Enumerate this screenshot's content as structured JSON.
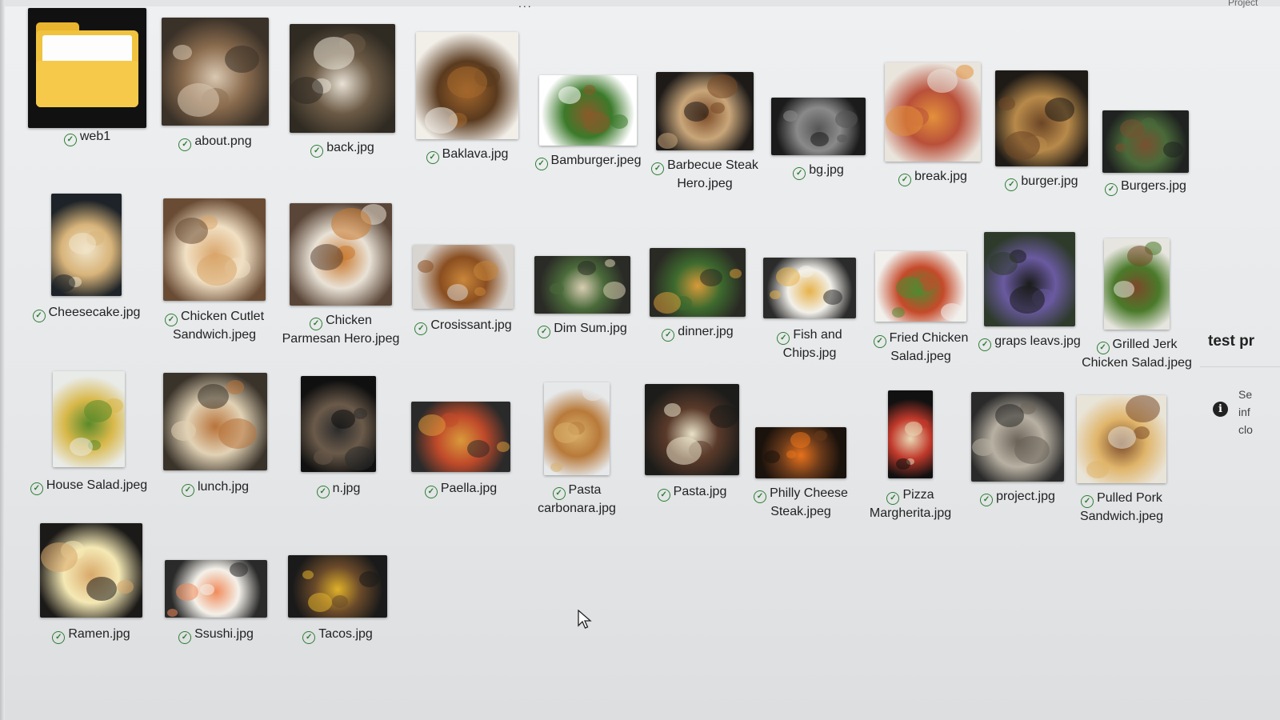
{
  "top": {
    "ellipsis": "...",
    "right_text": "Project"
  },
  "files": [
    {
      "name": "web1",
      "type": "folder",
      "colors": [
        "#111111",
        "#f0c23e"
      ]
    },
    {
      "name": "about.png",
      "colors": [
        "#3a3128",
        "#d9c8b2",
        "#8c6d4f"
      ]
    },
    {
      "name": "back.jpg",
      "colors": [
        "#2f2a22",
        "#e8e1d5",
        "#6b5a45"
      ]
    },
    {
      "name": "Baklava.jpg",
      "colors": [
        "#f2efe9",
        "#a4672c",
        "#5a3a1e"
      ]
    },
    {
      "name": "Bamburger.jpeg",
      "colors": [
        "#ffffff",
        "#8a5a2a",
        "#3b7a2a"
      ]
    },
    {
      "name": "Barbecue Steak Hero.jpeg",
      "colors": [
        "#1d1a18",
        "#7a4a26",
        "#c9a67a"
      ]
    },
    {
      "name": "bg.jpg",
      "colors": [
        "#1b1b1b",
        "#555555",
        "#8a8a8a"
      ]
    },
    {
      "name": "break.jpg",
      "colors": [
        "#e9e4dc",
        "#e3913b",
        "#b9503a"
      ]
    },
    {
      "name": "burger.jpg",
      "colors": [
        "#1e1a16",
        "#6b4526",
        "#b88a4a"
      ]
    },
    {
      "name": "Burgers.jpg",
      "colors": [
        "#1f2220",
        "#7a5030",
        "#4a6a3a"
      ]
    },
    {
      "name": "Cheesecake.jpg",
      "colors": [
        "#1d2328",
        "#f0e4c9",
        "#d8b47a"
      ]
    },
    {
      "name": "Chicken Cutlet Sandwich.jpeg",
      "colors": [
        "#6a4c35",
        "#d9a56a",
        "#f1e0c4"
      ]
    },
    {
      "name": "Chicken Parmesan Hero.jpeg",
      "colors": [
        "#5a4638",
        "#c8782e",
        "#e9e2d6"
      ]
    },
    {
      "name": "Crosissant.jpg",
      "colors": [
        "#d8d4cf",
        "#c9863a",
        "#8a4e20"
      ]
    },
    {
      "name": "Dim Sum.jpg",
      "colors": [
        "#2a2a26",
        "#d8cdb2",
        "#4a6a3a"
      ]
    },
    {
      "name": "dinner.jpg",
      "colors": [
        "#2a2a24",
        "#d89a3a",
        "#3d6a2e"
      ]
    },
    {
      "name": "Fish and Chips.jpg",
      "colors": [
        "#2b2b2b",
        "#e7b24a",
        "#f2f0ea"
      ]
    },
    {
      "name": "Fried Chicken Salad.jpeg",
      "colors": [
        "#f1f0ed",
        "#4f8a32",
        "#c54a2a"
      ]
    },
    {
      "name": "graps leavs.jpg",
      "colors": [
        "#2e3a2a",
        "#1a1c1a",
        "#6a5aa0"
      ]
    },
    {
      "name": "Grilled Jerk Chicken Salad.jpeg",
      "colors": [
        "#e7e5df",
        "#7a4a2a",
        "#4a7a2a"
      ]
    },
    {
      "name": "House Salad.jpeg",
      "colors": [
        "#e9ebe8",
        "#5a8a2a",
        "#d8b84a"
      ]
    },
    {
      "name": "lunch.jpg",
      "colors": [
        "#3a332a",
        "#b8733a",
        "#e1d2b5"
      ]
    },
    {
      "name": "n.jpg",
      "colors": [
        "#101010",
        "#2b2b2b",
        "#6a5a4a"
      ]
    },
    {
      "name": "Paella.jpg",
      "colors": [
        "#2a2a2a",
        "#d99a3a",
        "#c04a2a"
      ]
    },
    {
      "name": "Pasta carbonara.jpg",
      "colors": [
        "#e6e8ea",
        "#d9b06a",
        "#b87a3a"
      ]
    },
    {
      "name": "Pasta.jpg",
      "colors": [
        "#1c1c1a",
        "#e9e2c9",
        "#5a3a2a"
      ]
    },
    {
      "name": "Philly Cheese Steak.jpeg",
      "colors": [
        "#1a120c",
        "#e8721c",
        "#6a3a1a"
      ]
    },
    {
      "name": "Pizza Margherita.jpg",
      "colors": [
        "#111111",
        "#e9d8b5",
        "#c0392b"
      ]
    },
    {
      "name": "project.jpg",
      "colors": [
        "#2a2a2a",
        "#6a6258",
        "#b8b0a2"
      ]
    },
    {
      "name": "Pulled Pork Sandwich.jpeg",
      "colors": [
        "#e9e4d8",
        "#7a4a2a",
        "#e0b56a"
      ]
    },
    {
      "name": "Ramen.jpg",
      "colors": [
        "#1c1a18",
        "#d8a86a",
        "#f5e9b5"
      ]
    },
    {
      "name": "Ssushi.jpg",
      "colors": [
        "#2a2a2a",
        "#f08a5a",
        "#f4f1ea"
      ]
    },
    {
      "name": "Tacos.jpg",
      "colors": [
        "#1a1a1a",
        "#e0b12a",
        "#6a4a2a"
      ]
    }
  ],
  "side": {
    "title": "test pr",
    "lines": [
      "Se",
      "inf",
      "clo"
    ]
  }
}
